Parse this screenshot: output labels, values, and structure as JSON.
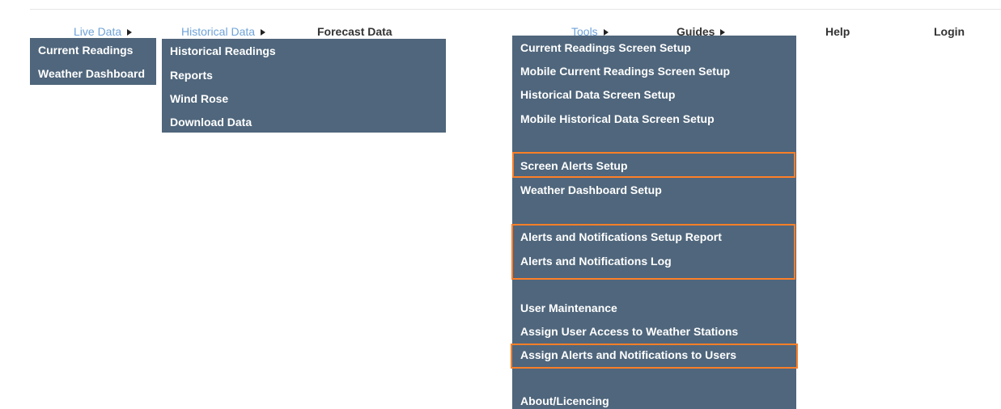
{
  "nav": {
    "live_data": "Live Data",
    "historical_data": "Historical Data",
    "forecast_data": "Forecast Data",
    "tools": "Tools",
    "guides": "Guides",
    "help": "Help",
    "login": "Login"
  },
  "live_menu": {
    "items": [
      "Current Readings",
      "Weather Dashboard"
    ]
  },
  "historical_menu": {
    "items": [
      "Historical Readings",
      "Reports",
      "Wind Rose",
      "Download Data"
    ]
  },
  "tools_menu": {
    "items": [
      "Current Readings Screen Setup",
      "Mobile Current Readings Screen Setup",
      "Historical Data Screen Setup",
      "Mobile Historical Data Screen Setup",
      "Screen Alerts Setup",
      "Weather Dashboard Setup",
      "Alerts and Notifications Setup Report",
      "Alerts and Notifications Log",
      "User Maintenance",
      "Assign User Access to Weather Stations",
      "Assign Alerts and Notifications to Users",
      "About/Licencing"
    ]
  },
  "colors": {
    "menu_bg": "#4f667c",
    "nav_active": "#6fa3d8",
    "highlight": "#ff7f27"
  }
}
